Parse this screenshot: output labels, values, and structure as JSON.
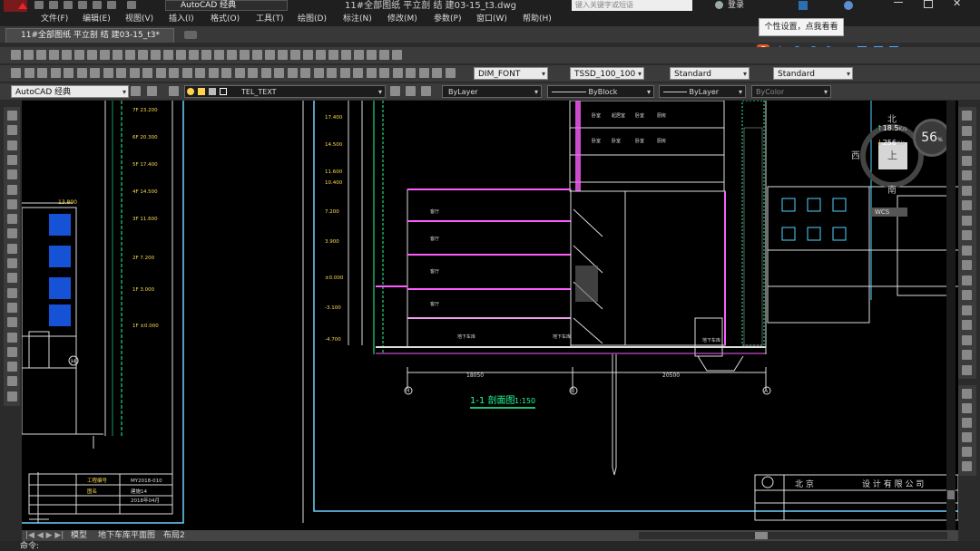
{
  "titlebar": {
    "workspace": "AutoCAD 经典",
    "file_title": "11#全部图纸 平立剖 结 建03-15_t3.dwg",
    "search_placeholder": "键入关键字或短语",
    "login": "登录"
  },
  "menu": [
    "文件(F)",
    "编辑(E)",
    "视图(V)",
    "插入(I)",
    "格式(O)",
    "工具(T)",
    "绘图(D)",
    "标注(N)",
    "修改(M)",
    "参数(P)",
    "窗口(W)",
    "帮助(H)"
  ],
  "doc_tab": "11#全部图纸 平立剖 结 建03-15_t3*",
  "tooltip": "个性设置，点我看看",
  "toolbar": {
    "dim_style": "DIM_FONT",
    "text_style": "TSSD_100_100",
    "table_style": "Standard",
    "multileader_style": "Standard",
    "workspace2": "AutoCAD 经典",
    "layer": "TEL_TEXT",
    "color": "ByLayer",
    "linetype": "ByBlock",
    "lineweight": "ByLayer",
    "plotstyle": "ByColor"
  },
  "viewcube": {
    "north": "北",
    "south": "南",
    "west": "西",
    "face": "上",
    "wcs": "WCS",
    "net_up": "18.5",
    "net_down": "256",
    "net_unit": "K/s",
    "percent": "56"
  },
  "drawing": {
    "section_title": "1-1 剖面图",
    "section_scale": "1:150",
    "dim_left": "18050",
    "dim_right": "20500",
    "axis_left": "H",
    "axis_mid": "B",
    "axis_right": "A",
    "title_block_city": "北 京",
    "title_block_company": "设 计 有 限 公 司",
    "left_elev_top": "13.800",
    "left_levels": [
      "7F 23.200",
      "6F 20.300",
      "5F 17.400",
      "4F 14.500",
      "3F 11.600",
      "2F 7.200",
      "1F 3.000",
      "1F ±0.000"
    ],
    "mid_levels": [
      "17.400",
      "14.500",
      "11.600",
      "10.400",
      "7.200",
      "3.900",
      "±0.000",
      "-3.100",
      "-4.700"
    ],
    "room_labels": [
      "卧室",
      "起居室",
      "卧室",
      "厨房",
      "卧室",
      "卧室",
      "卧室",
      "厨房"
    ],
    "rooms_lower": [
      "客厅",
      "客厅",
      "客厅",
      "客厅",
      "地下车库",
      "地下车库",
      "地下车库"
    ],
    "small_table": [
      "工程编号",
      "MY2018-010",
      "图名",
      "建施14",
      "2018年04月"
    ]
  },
  "layout_tabs": [
    "模型",
    "地下车库平面图",
    "布局2"
  ],
  "cmd": "命令:"
}
